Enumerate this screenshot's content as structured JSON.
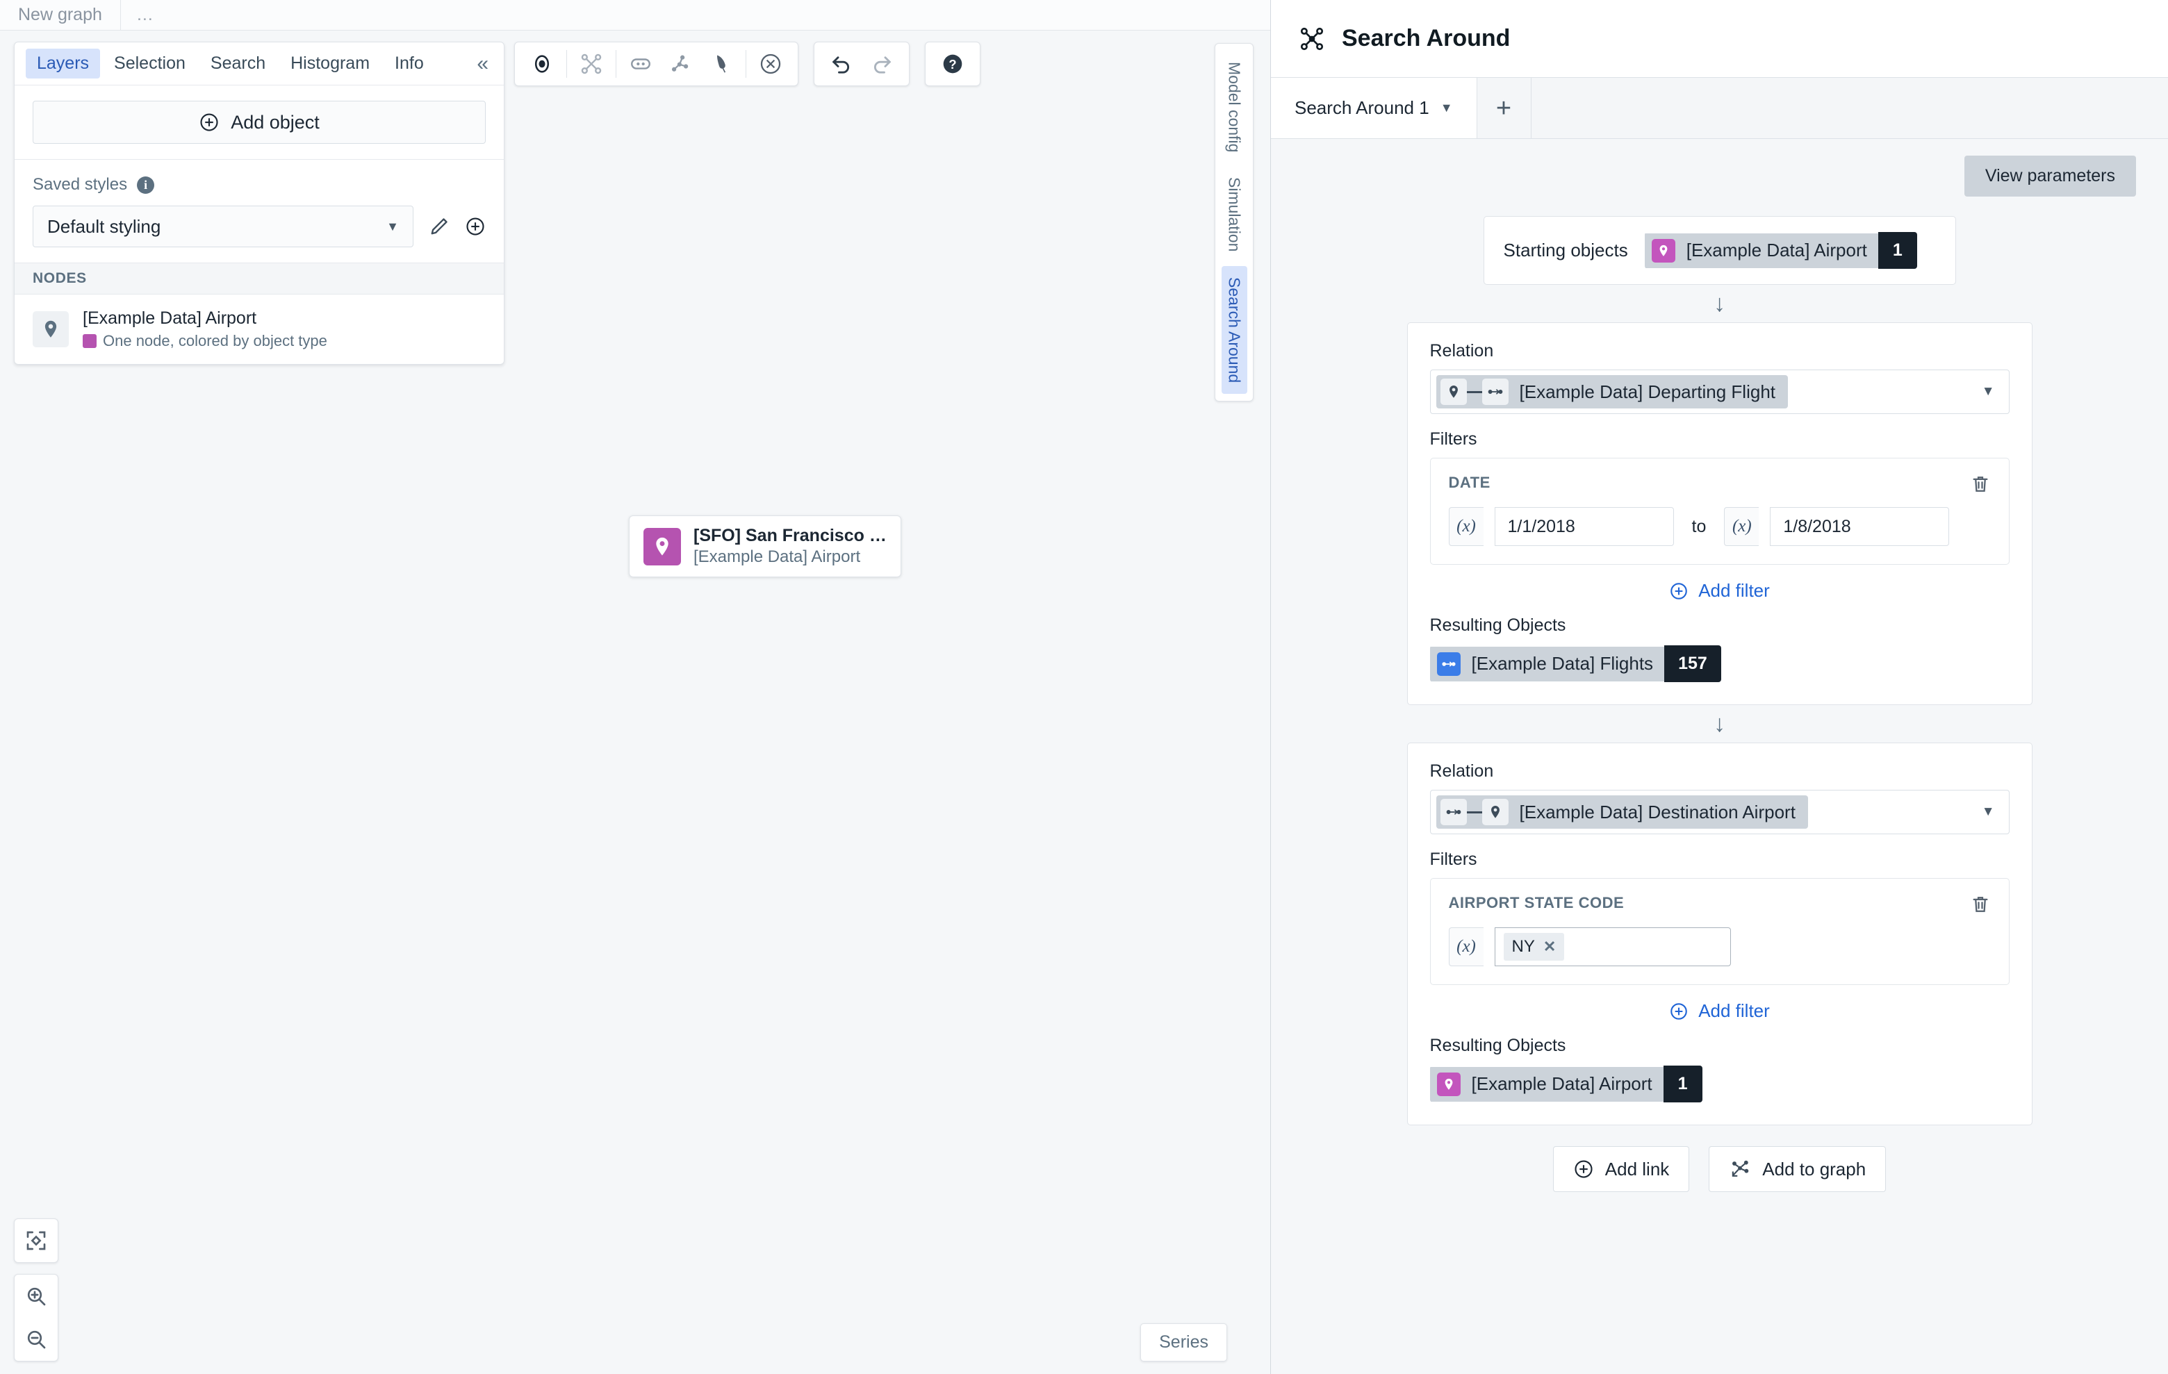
{
  "topbar": {
    "graph_name": "New graph",
    "more": "…"
  },
  "left_panel": {
    "tabs": [
      {
        "label": "Layers",
        "active": true
      },
      {
        "label": "Selection",
        "active": false
      },
      {
        "label": "Search",
        "active": false
      },
      {
        "label": "Histogram",
        "active": false
      },
      {
        "label": "Info",
        "active": false
      }
    ],
    "collapse_icon": "«",
    "add_object_label": "Add object",
    "saved_styles_label": "Saved styles",
    "saved_styles_value": "Default styling",
    "nodes_header": "NODES",
    "node": {
      "title": "[Example Data] Airport",
      "subtitle": "One node, colored by object type",
      "swatch_color": "#b553b0"
    }
  },
  "canvas": {
    "toolbar": [
      "select-tool-icon",
      "graph-expand-icon",
      "link-pill-icon",
      "molecule-icon",
      "pen-icon",
      "clear-icon",
      "undo-icon",
      "redo-icon",
      "help-icon"
    ],
    "rail_tabs": [
      {
        "label": "Model config",
        "active": false
      },
      {
        "label": "Simulation",
        "active": false
      },
      {
        "label": "Search Around",
        "active": true
      }
    ],
    "node": {
      "title": "[SFO] San Francisco …",
      "subtitle": "[Example Data] Airport",
      "color": "#b553b0"
    },
    "series_label": "Series"
  },
  "right_panel": {
    "title": "Search Around",
    "tab": "Search Around 1",
    "add_tab": "+",
    "view_parameters": "View parameters",
    "starting": {
      "label": "Starting objects",
      "object": "[Example Data] Airport",
      "count": "1",
      "icon_color": "#c355bd"
    },
    "steps": [
      {
        "relation_label": "Relation",
        "relation_value": "[Example Data] Departing Flight",
        "relation_icons": [
          "map-pin-icon",
          "flight-link-icon"
        ],
        "filters_label": "Filters",
        "filter": {
          "name": "DATE",
          "type": "range",
          "from": "1/1/2018",
          "to_word": "to",
          "to": "1/8/2018",
          "fx": "(x)"
        },
        "add_filter_label": "Add filter",
        "results_label": "Resulting Objects",
        "result_object": "[Example Data] Flights",
        "result_count": "157",
        "result_icon_color": "#3b7de8"
      },
      {
        "relation_label": "Relation",
        "relation_value": "[Example Data] Destination Airport",
        "relation_icons": [
          "flight-link-icon",
          "map-pin-icon"
        ],
        "filters_label": "Filters",
        "filter": {
          "name": "AIRPORT STATE CODE",
          "type": "tags",
          "tag": "NY",
          "fx": "(x)"
        },
        "add_filter_label": "Add filter",
        "results_label": "Resulting Objects",
        "result_object": "[Example Data] Airport",
        "result_count": "1",
        "result_icon_color": "#c355bd"
      }
    ],
    "footer": {
      "add_link": "Add link",
      "add_to_graph": "Add to graph"
    }
  }
}
